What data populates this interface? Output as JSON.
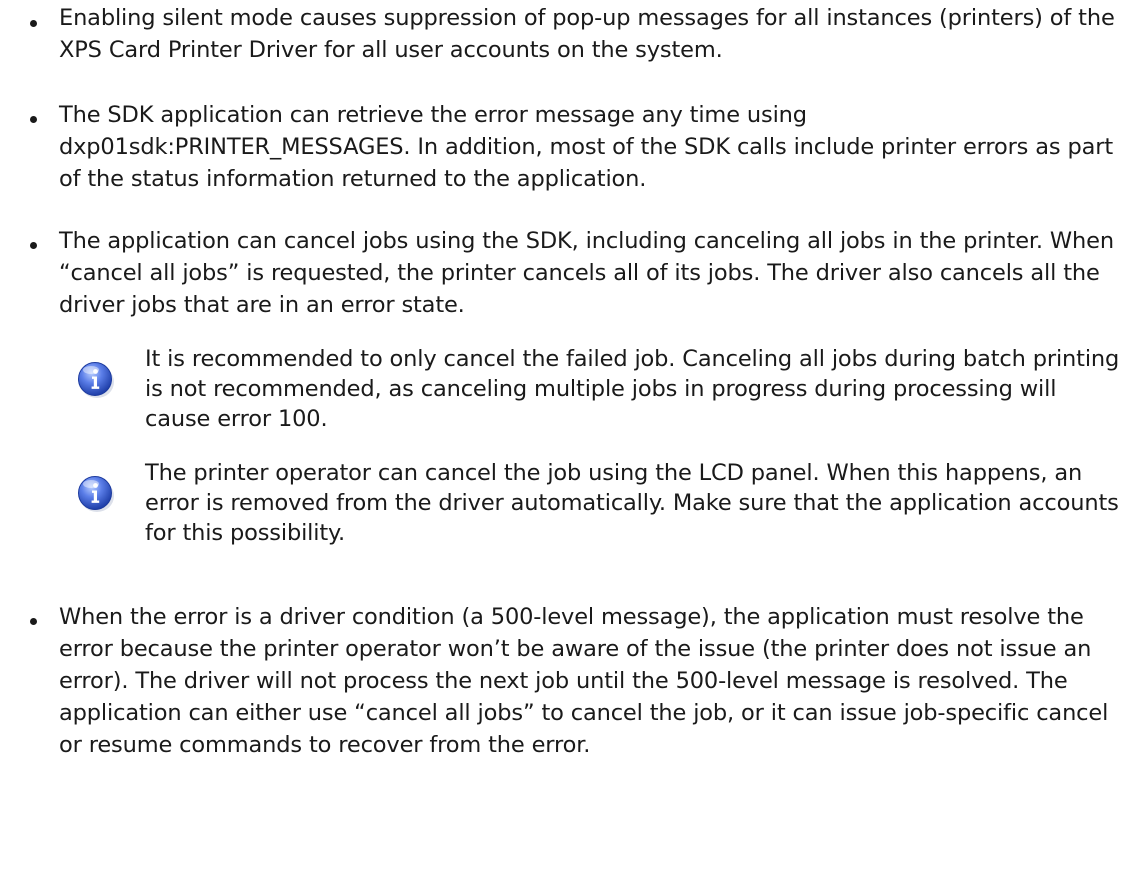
{
  "bullets": [
    "Enabling silent mode causes suppression of pop-up messages for all instances (printers) of the XPS Card Printer Driver for all user accounts on the system.",
    "The SDK application can retrieve the error message any time using dxp01sdk:PRINTER_MESSAGES. In addition, most of the SDK calls include printer errors as part of the status information returned to the application.",
    "The application can cancel jobs using the SDK, including canceling all jobs in the printer. When “cancel all jobs” is requested, the printer cancels all of its jobs. The driver also cancels all the driver jobs that are in an error state.",
    "When the error is a driver condition (a 500-level message), the application must resolve the error because the printer operator won’t be aware of the issue (the printer does not issue an error). The driver will not process the next job until the 500-level message is resolved. The application can either use “cancel all jobs” to cancel the job, or it can issue job-specific cancel or resume commands to recover from the error."
  ],
  "notes": [
    {
      "icon": "info-icon",
      "text": "It is recommended to only cancel the failed job. Canceling all jobs during batch printing is not recommended, as canceling multiple jobs in progress during processing will cause error 100."
    },
    {
      "icon": "info-icon",
      "text": "The printer operator can cancel the job using the LCD panel. When this happens, an error is removed from the driver automatically. Make sure that the application accounts for this possibility."
    }
  ],
  "colors": {
    "text": "#1a1a1a",
    "info_icon_blue": "#2f56c8",
    "info_icon_light": "#8fb0ff"
  }
}
